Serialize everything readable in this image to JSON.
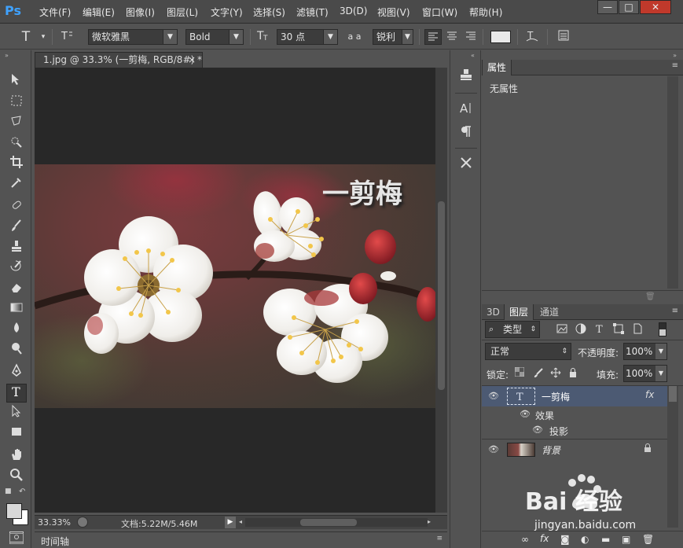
{
  "app": {
    "logo": "Ps"
  },
  "menu": [
    "文件(F)",
    "编辑(E)",
    "图像(I)",
    "图层(L)",
    "文字(Y)",
    "选择(S)",
    "滤镜(T)",
    "3D(D)",
    "视图(V)",
    "窗口(W)",
    "帮助(H)"
  ],
  "window_controls": [
    "—",
    "□",
    "✕"
  ],
  "options": {
    "tool_icon": "T",
    "font_family": "微软雅黑",
    "font_style": "Bold",
    "font_size": "30 点",
    "aa_label": "a a",
    "antialias": "锐利"
  },
  "document": {
    "tab_title": "1.jpg @ 33.3% (一剪梅, RGB/8#) *",
    "tab_close": "×",
    "image_text": "一剪梅",
    "zoom": "33.33%",
    "doc_info": "文档:5.22M/5.46M"
  },
  "timeline": {
    "label": "时间轴"
  },
  "properties": {
    "tab": "属性",
    "content": "无属性"
  },
  "layers_panel": {
    "tabs": [
      "3D",
      "图层",
      "通道"
    ],
    "active_tab": "图层",
    "filter_kind": "类型",
    "blend_mode": "正常",
    "opacity_label": "不透明度:",
    "opacity": "100%",
    "lock_label": "锁定:",
    "fill_label": "填充:",
    "fill": "100%",
    "layers": [
      {
        "name": "一剪梅",
        "type": "text",
        "fx": "fx",
        "selected": true
      },
      {
        "name": "效果",
        "type": "effect"
      },
      {
        "name": "投影",
        "type": "effect-item"
      },
      {
        "name": "背景",
        "type": "background",
        "locked": true
      }
    ]
  },
  "watermark": {
    "text": "Bai 经验",
    "url": "jingyan.baidu.com"
  },
  "colors": {
    "accent": "#3fa2ff",
    "selected_layer": "#4c5a73",
    "panel_bg": "#535353",
    "canvas_bg": "#282828"
  }
}
